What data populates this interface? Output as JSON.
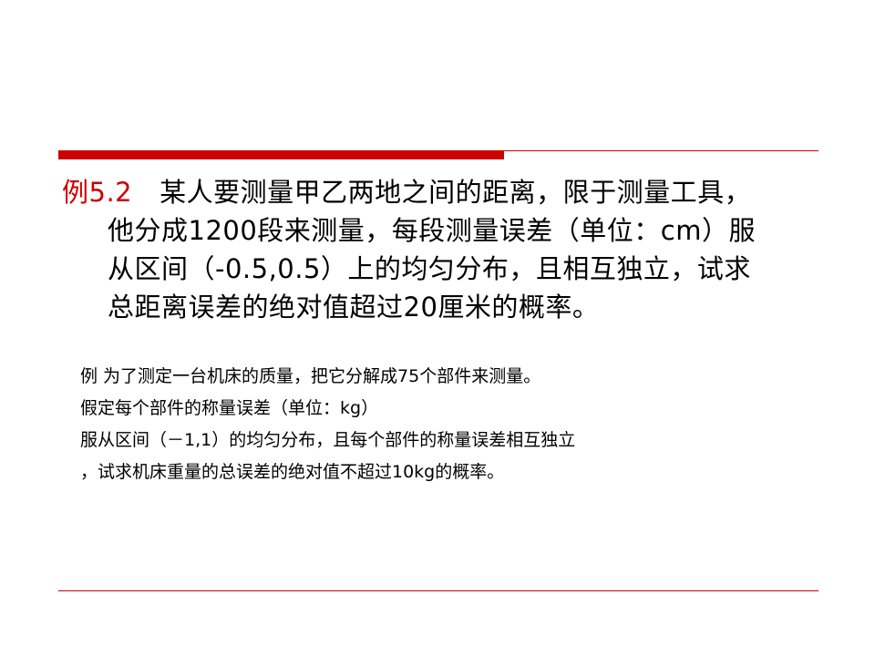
{
  "colors": {
    "accent": "#cc0000"
  },
  "main_example": {
    "label": "例5.2",
    "lines": [
      "某人要测量甲乙两地之间的距离，限于测量工具，",
      "他分成1200段来测量，每段测量误差（单位：cm）服",
      "从区间（-0.5,0.5）上的均匀分布，且相互独立，试求",
      "总距离误差的绝对值超过20厘米的概率。"
    ]
  },
  "sub_example": {
    "lines": [
      "例   为了测定一台机床的质量，把它分解成75个部件来测量。",
      "假定每个部件的称量误差（单位：kg）",
      "服从区间（－1,1）的均匀分布，且每个部件的称量误差相互独立",
      "，试求机床重量的总误差的绝对值不超过10kg的概率。"
    ]
  }
}
